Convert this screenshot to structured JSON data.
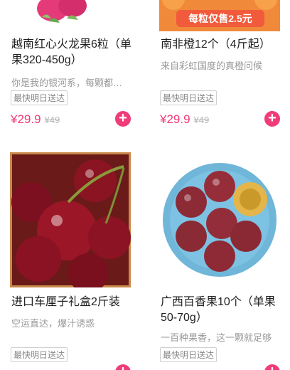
{
  "products": [
    {
      "title": "越南红心火龙果6粒（单果320-450g）",
      "subtitle": "你是我的银河系，每颗都…",
      "badge": "最快明日送达",
      "price": "¥29.9",
      "original_price": "¥49"
    },
    {
      "title": "南非橙12个（4斤起）",
      "subtitle": "来自彩虹国度的真橙问候",
      "badge": "最快明日送达",
      "price": "¥29.9",
      "original_price": "¥49",
      "image_text": "每粒仅售2.5元"
    },
    {
      "title": "进口车厘子礼盒2斤装",
      "subtitle": "空运直达，爆汁诱惑",
      "badge": "最快明日送达"
    },
    {
      "title": "广西百香果10个（单果50-70g）",
      "subtitle": "一百种果香，这一颗就足够",
      "badge": "最快明日送达"
    }
  ],
  "add_icon": "plus-icon",
  "colors": {
    "accent": "#f03c78",
    "muted": "#999999"
  }
}
